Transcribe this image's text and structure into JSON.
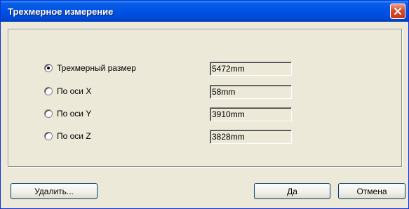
{
  "window": {
    "title": "Трехмерное измерение"
  },
  "options": [
    {
      "label": "Трехмерный размер",
      "value": "5472mm",
      "selected": true
    },
    {
      "label": "По оси X",
      "value": "58mm",
      "selected": false
    },
    {
      "label": "По оси Y",
      "value": "3910mm",
      "selected": false
    },
    {
      "label": "По оси Z",
      "value": "3828mm",
      "selected": false
    }
  ],
  "buttons": {
    "delete": "Удалить...",
    "ok": "Да",
    "cancel": "Отмена"
  },
  "icons": {
    "close": "close-icon"
  },
  "colors": {
    "titlebar": "#0052e4",
    "close": "#d9482a",
    "window_bg": "#ece9d8"
  }
}
